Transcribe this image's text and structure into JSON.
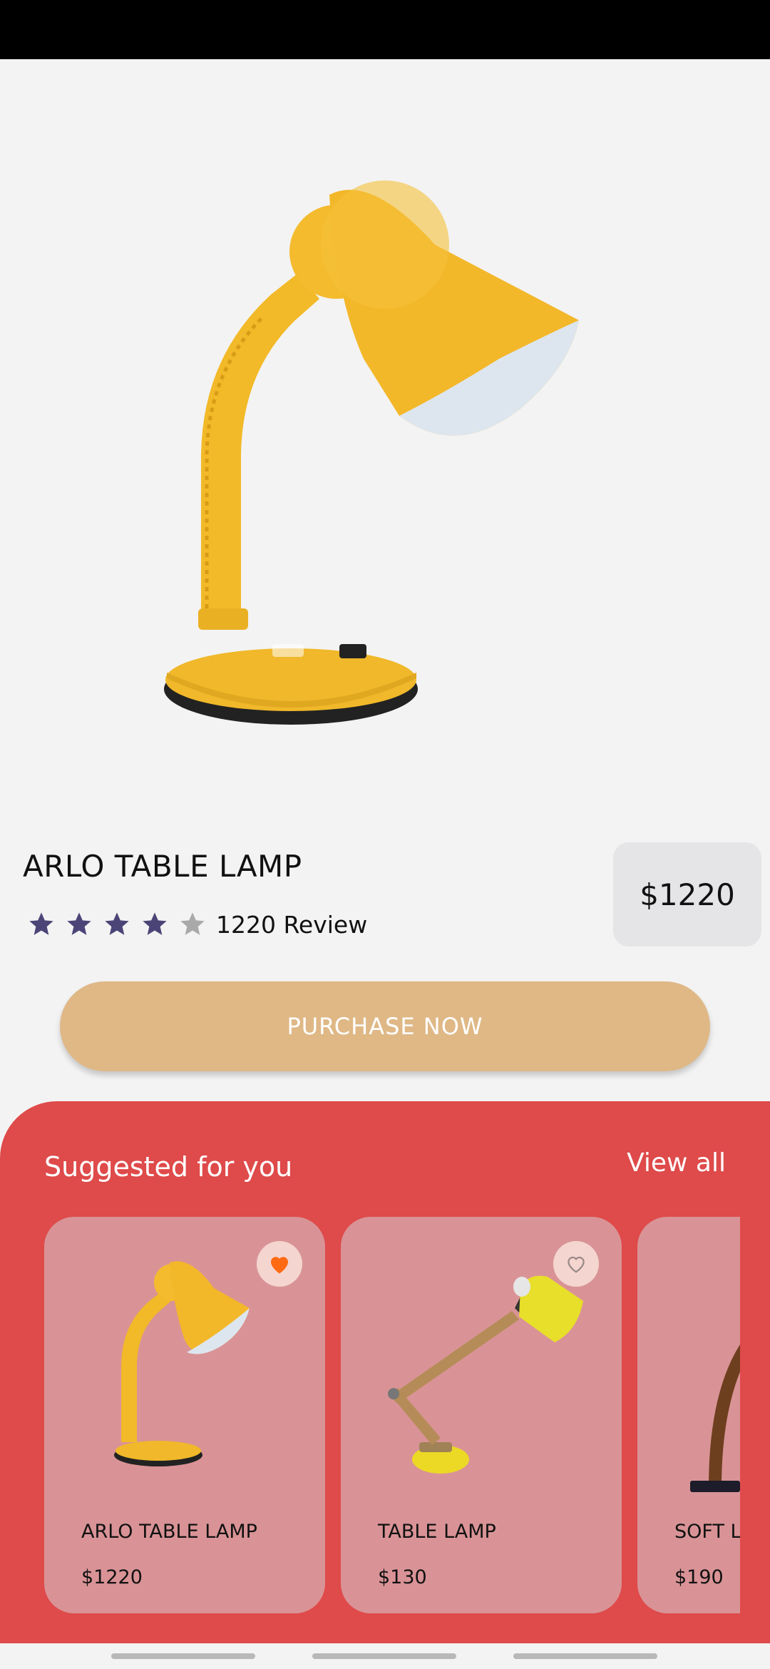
{
  "product": {
    "title": "ARLO TABLE LAMP",
    "rating": 4,
    "rating_max": 5,
    "review_text": "1220 Review",
    "price": "$1220",
    "image_icon": "yellow-desk-lamp"
  },
  "actions": {
    "purchase_label": "PURCHASE NOW"
  },
  "suggested": {
    "title": "Suggested for you",
    "view_all": "View all",
    "items": [
      {
        "name": "ARLO TABLE LAMP",
        "price": "$1220",
        "favorite": true
      },
      {
        "name": "TABLE LAMP",
        "price": "$130",
        "favorite": false
      },
      {
        "name": "SOFT L",
        "price": "$190",
        "favorite": false
      }
    ]
  },
  "colors": {
    "accent_red": "#df4a4a",
    "purchase_button": "#dfb886",
    "star_filled": "#4b4577",
    "star_empty": "#a9a9a9",
    "favorite_orange": "#ff6a13",
    "card_bg": "#d99396"
  }
}
